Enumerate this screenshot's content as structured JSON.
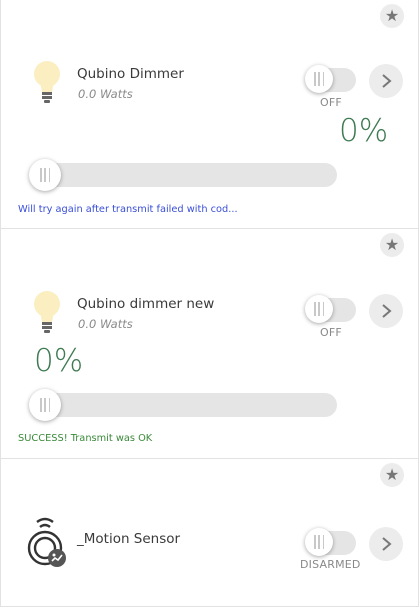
{
  "colors": {
    "percent": "#3e7a52",
    "status_fail": "#3a4fd8",
    "status_ok": "#3a8a3a"
  },
  "devices": [
    {
      "name": "Qubino Dimmer",
      "power": "0.0 Watts",
      "switch_state": "OFF",
      "level_text": "0%",
      "level": 0,
      "status": "Will try again after transmit failed with cod...",
      "icon": "lightbulb-icon"
    },
    {
      "name": "Qubino dimmer new",
      "power": "0.0 Watts",
      "switch_state": "OFF",
      "level_text": "0%",
      "level": 0,
      "status": "SUCCESS! Transmit was OK",
      "icon": "lightbulb-icon"
    },
    {
      "name": "_Motion Sensor",
      "switch_state": "DISARMED",
      "icon": "motion-sensor-icon"
    }
  ],
  "icons": {
    "favorite": "star-icon",
    "details": "chevron-right-icon"
  }
}
